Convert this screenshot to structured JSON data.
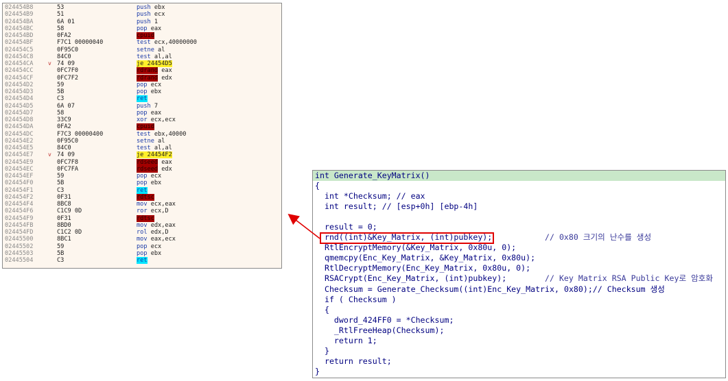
{
  "disassembly": [
    {
      "addr": "024454B8",
      "bytes": "53",
      "mn": "push",
      "op": "ebx"
    },
    {
      "addr": "024454B9",
      "bytes": "51",
      "mn": "push",
      "op": "ecx"
    },
    {
      "addr": "024454BA",
      "bytes": "6A 01",
      "mn": "push",
      "op": "1"
    },
    {
      "addr": "024454BC",
      "bytes": "58",
      "mn": "pop",
      "op": "eax"
    },
    {
      "addr": "024454BD",
      "bytes": "0FA2",
      "mn": "cpuid",
      "op": "",
      "hl": "red"
    },
    {
      "addr": "024454BF",
      "bytes": "F7C1 00000040",
      "mn": "test",
      "op": "ecx,40000000"
    },
    {
      "addr": "024454C5",
      "bytes": "0F95C0",
      "mn": "setne",
      "op": "al"
    },
    {
      "addr": "024454C8",
      "bytes": "84C0",
      "mn": "test",
      "op": "al,al"
    },
    {
      "addr": "024454CA",
      "bytes": "74 09",
      "mn": "je",
      "op": "24454D5",
      "hl": "yel",
      "arrow": "v"
    },
    {
      "addr": "024454CC",
      "bytes": "0FC7F0",
      "mn": "rdrand",
      "op": "eax",
      "hl": "red"
    },
    {
      "addr": "024454CF",
      "bytes": "0FC7F2",
      "mn": "rdrand",
      "op": "edx",
      "hl": "red"
    },
    {
      "addr": "024454D2",
      "bytes": "59",
      "mn": "pop",
      "op": "ecx"
    },
    {
      "addr": "024454D3",
      "bytes": "5B",
      "mn": "pop",
      "op": "ebx"
    },
    {
      "addr": "024454D4",
      "bytes": "C3",
      "mn": "ret",
      "op": "",
      "hl": "cyan"
    },
    {
      "addr": "024454D5",
      "bytes": "6A 07",
      "mn": "push",
      "op": "7"
    },
    {
      "addr": "024454D7",
      "bytes": "58",
      "mn": "pop",
      "op": "eax"
    },
    {
      "addr": "024454D8",
      "bytes": "33C9",
      "mn": "xor",
      "op": "ecx,ecx"
    },
    {
      "addr": "024454DA",
      "bytes": "0FA2",
      "mn": "cpuid",
      "op": "",
      "hl": "red"
    },
    {
      "addr": "024454DC",
      "bytes": "F7C3 00000400",
      "mn": "test",
      "op": "ebx,40000"
    },
    {
      "addr": "024454E2",
      "bytes": "0F95C0",
      "mn": "setne",
      "op": "al"
    },
    {
      "addr": "024454E5",
      "bytes": "84C0",
      "mn": "test",
      "op": "al,al"
    },
    {
      "addr": "024454E7",
      "bytes": "74 09",
      "mn": "je",
      "op": "24454F2",
      "hl": "yel",
      "arrow": "v"
    },
    {
      "addr": "024454E9",
      "bytes": "0FC7F8",
      "mn": "rdseed",
      "op": "eax",
      "hl": "red"
    },
    {
      "addr": "024454EC",
      "bytes": "0FC7FA",
      "mn": "rdseed",
      "op": "edx",
      "hl": "red"
    },
    {
      "addr": "024454EF",
      "bytes": "59",
      "mn": "pop",
      "op": "ecx"
    },
    {
      "addr": "024454F0",
      "bytes": "5B",
      "mn": "pop",
      "op": "ebx"
    },
    {
      "addr": "024454F1",
      "bytes": "C3",
      "mn": "ret",
      "op": "",
      "hl": "cyan"
    },
    {
      "addr": "024454F2",
      "bytes": "0F31",
      "mn": "rdtsc",
      "op": "",
      "hl": "red"
    },
    {
      "addr": "024454F4",
      "bytes": "8BC8",
      "mn": "mov",
      "op": "ecx,eax"
    },
    {
      "addr": "024454F6",
      "bytes": "C1C9 0D",
      "mn": "ror",
      "op": "ecx,D"
    },
    {
      "addr": "024454F9",
      "bytes": "0F31",
      "mn": "rdtsc",
      "op": "",
      "hl": "red"
    },
    {
      "addr": "024454FB",
      "bytes": "8BD0",
      "mn": "mov",
      "op": "edx,eax"
    },
    {
      "addr": "024454FD",
      "bytes": "C1C2 0D",
      "mn": "rol",
      "op": "edx,D"
    },
    {
      "addr": "02445500",
      "bytes": "8BC1",
      "mn": "mov",
      "op": "eax,ecx"
    },
    {
      "addr": "02445502",
      "bytes": "59",
      "mn": "pop",
      "op": "ecx"
    },
    {
      "addr": "02445503",
      "bytes": "5B",
      "mn": "pop",
      "op": "ebx"
    },
    {
      "addr": "02445504",
      "bytes": "C3",
      "mn": "ret",
      "op": "",
      "hl": "cyan"
    }
  ],
  "code": {
    "header": "int Generate_KeyMatrix()",
    "lines": [
      {
        "indent": 0,
        "text": "{"
      },
      {
        "indent": 1,
        "text": "int *Checksum; // eax"
      },
      {
        "indent": 1,
        "text": "int result; // [esp+0h] [ebp-4h]"
      },
      {
        "indent": 0,
        "text": ""
      },
      {
        "indent": 1,
        "text": "result = 0;"
      },
      {
        "indent": 1,
        "text": "rnd((int)&Key_Matrix, (int)pubkey);",
        "comment": "// 0x80 크기의 난수를 생성"
      },
      {
        "indent": 1,
        "text": "RtlEncryptMemory(&Key_Matrix, 0x80u, 0);"
      },
      {
        "indent": 1,
        "text": "qmemcpy(Enc_Key_Matrix, &Key_Matrix, 0x80u);"
      },
      {
        "indent": 1,
        "text": "RtlDecryptMemory(Enc_Key_Matrix, 0x80u, 0);"
      },
      {
        "indent": 1,
        "text": "RSACrypt(Enc_Key_Matrix, (int)pubkey);",
        "comment": "// Key Matrix RSA Public Key로 암호화"
      },
      {
        "indent": 1,
        "text": "Checksum = Generate_Checksum((int)Enc_Key_Matrix, 0x80);// Checksum 생성"
      },
      {
        "indent": 1,
        "text": "if ( Checksum )"
      },
      {
        "indent": 1,
        "text": "{"
      },
      {
        "indent": 2,
        "text": "dword_424FF0 = *Checksum;"
      },
      {
        "indent": 2,
        "text": "_RtlFreeHeap(Checksum);"
      },
      {
        "indent": 2,
        "text": "return 1;"
      },
      {
        "indent": 1,
        "text": "}"
      },
      {
        "indent": 1,
        "text": "return result;"
      },
      {
        "indent": 0,
        "text": "}"
      }
    ]
  }
}
